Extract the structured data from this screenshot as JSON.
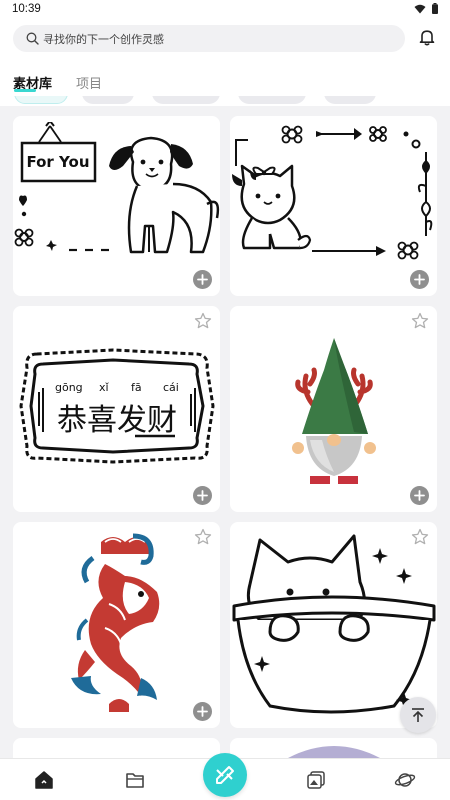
{
  "status_bar": {
    "time": "10:39"
  },
  "search": {
    "placeholder": "寻找你的下一个创作灵感"
  },
  "tabs": [
    {
      "label": "素材库",
      "active": true
    },
    {
      "label": "项目",
      "active": false
    }
  ],
  "cards": [
    {
      "name": "for-you-dog-sticker",
      "sign_text": "For You",
      "starred": false
    },
    {
      "name": "cat-flower-frame-sticker",
      "starred": false
    },
    {
      "name": "gongxi-facai-sticker",
      "pinyin": [
        "gōng",
        "xǐ",
        "fā",
        "cái"
      ],
      "text": "恭喜发财",
      "starred": false
    },
    {
      "name": "gnome-sticker",
      "starred": false
    },
    {
      "name": "koi-fish-sticker",
      "starred": false
    },
    {
      "name": "cat-in-bowl-sticker",
      "starred": false
    }
  ],
  "icons": {
    "search": "search-icon",
    "bell": "bell-icon",
    "star": "star-icon",
    "add": "add-icon",
    "scroll_top": "scroll-to-top-icon",
    "nav": [
      "home-icon",
      "folder-icon",
      "create-icon",
      "gallery-icon",
      "planet-icon"
    ]
  },
  "colors": {
    "accent": "#2fd0cf",
    "tab_underline": "#38d7d0",
    "background": "#f2f2f4"
  }
}
